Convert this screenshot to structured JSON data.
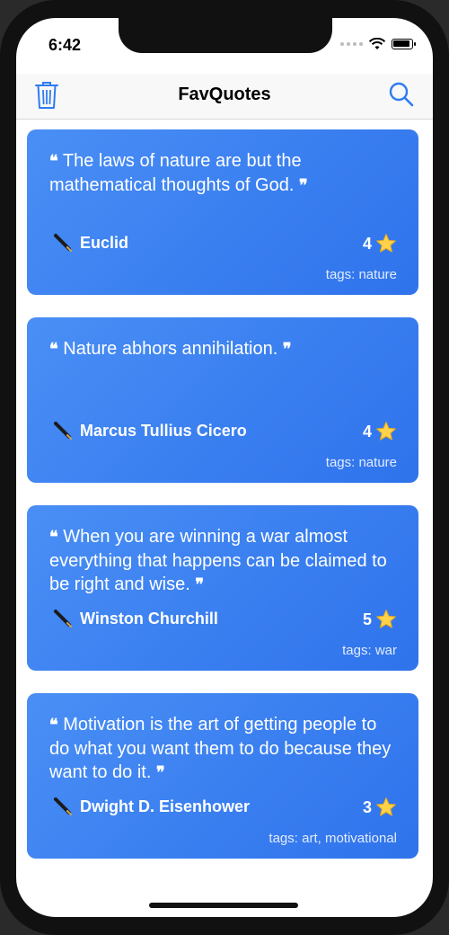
{
  "status_bar": {
    "time": "6:42"
  },
  "nav": {
    "title": "FavQuotes",
    "left_icon": "trash-icon",
    "right_icon": "search-icon",
    "accent_color": "#2f7bf0"
  },
  "quotes": [
    {
      "text": "The laws of nature are but the mathematical thoughts of God.",
      "author": "Euclid",
      "rating": "4",
      "tags": "tags: nature"
    },
    {
      "text": "Nature abhors annihilation.",
      "author": "Marcus Tullius Cicero",
      "rating": "4",
      "tags": "tags: nature"
    },
    {
      "text": "When you are winning a war almost everything that happens can be claimed to be right and wise.",
      "author": "Winston Churchill",
      "rating": "5",
      "tags": "tags: war"
    },
    {
      "text": "Motivation is the art of getting people to do what you want them to do because they want to do it.",
      "author": "Dwight D. Eisenhower",
      "rating": "3",
      "tags": "tags: art, motivational"
    }
  ],
  "card_color": "#3a7ff0",
  "icons": {
    "author": "fountain-pen-icon",
    "rating": "star-icon",
    "quote_open": "open-quote-icon",
    "quote_close": "close-quote-icon"
  }
}
